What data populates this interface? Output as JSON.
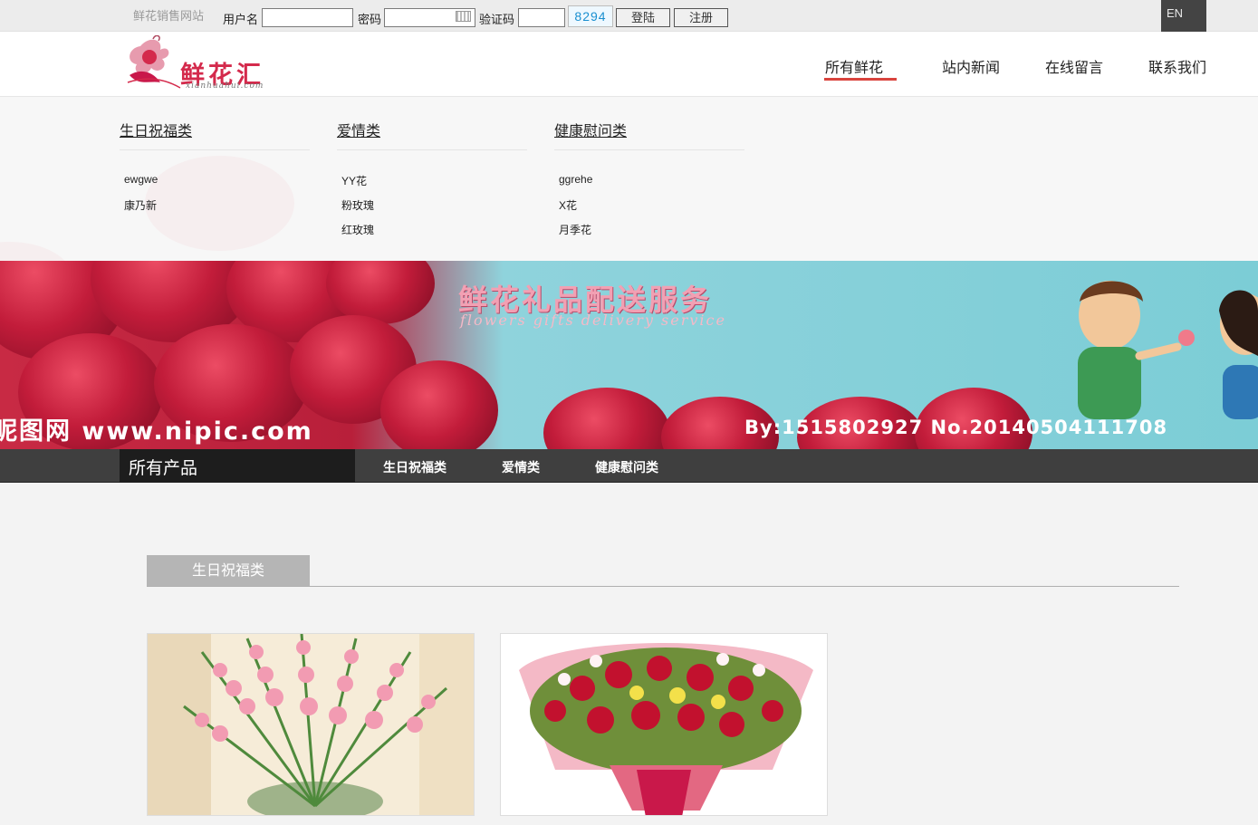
{
  "topbar": {
    "site_name": "鲜花销售网站",
    "username_label": "用户名",
    "password_label": "密码",
    "captcha_label": "验证码",
    "captcha_code": "8294",
    "login_button": "登陆",
    "register_button": "注册",
    "lang_button": "EN"
  },
  "header": {
    "logo_text": "鲜花汇",
    "logo_domain": "xianhuahui.com",
    "nav": [
      "所有鲜花",
      "站内新闻",
      "在线留言",
      "联系我们"
    ],
    "active_nav": "所有鲜花"
  },
  "mega_menu": {
    "categories": [
      {
        "title": "生日祝福类",
        "items": [
          "ewgwe",
          "康乃新"
        ]
      },
      {
        "title": "爱情类",
        "items": [
          "YY花",
          "粉玫瑰",
          "红玫瑰"
        ]
      },
      {
        "title": "健康慰问类",
        "items": [
          "ggrehe",
          "X花",
          "月季花"
        ]
      }
    ]
  },
  "banner": {
    "title": "鲜花礼品配送服务",
    "subtitle": "flowers gifts delivery service",
    "watermark_left": "昵图网 www.nipic.com",
    "watermark_right": "By:1515802927 No.20140504111708"
  },
  "category_bar": {
    "title": "所有产品",
    "links": [
      "生日祝福类",
      "爱情类",
      "健康慰问类"
    ]
  },
  "section": {
    "tab_label": "生日祝福类"
  },
  "colors": {
    "accent": "#d9433d",
    "brand": "#d42a4c",
    "dark_bar": "#3f3f3f"
  }
}
